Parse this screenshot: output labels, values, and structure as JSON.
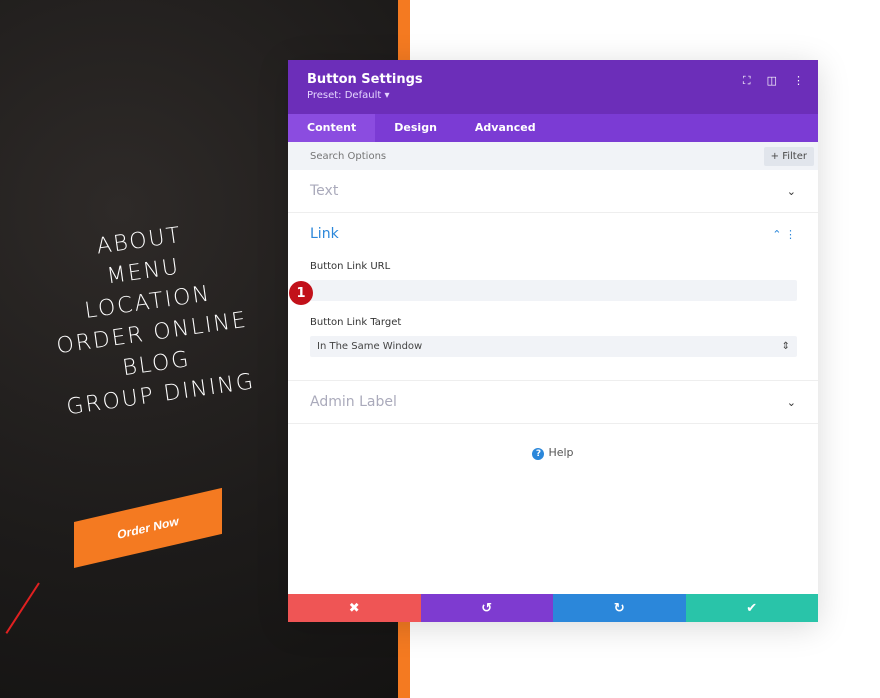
{
  "page": {
    "menu": [
      "ABOUT",
      "MENU",
      "LOCATION",
      "ORDER ONLINE",
      "BLOG",
      "GROUP DINING"
    ],
    "order_button": "Order Now",
    "step_badge": "1"
  },
  "modal": {
    "title": "Button Settings",
    "preset": "Preset: Default ▾",
    "tabs": [
      "Content",
      "Design",
      "Advanced"
    ],
    "search_placeholder": "Search Options",
    "filter": "+ Filter",
    "sections": {
      "text": "Text",
      "link": "Link",
      "admin": "Admin Label"
    },
    "link_url_label": "Button Link URL",
    "link_url_value": "",
    "link_target_label": "Button Link Target",
    "link_target_value": "In The Same Window",
    "help": "Help",
    "footer_icons": [
      "close-icon",
      "undo-icon",
      "redo-icon",
      "check-icon"
    ]
  },
  "colors": {
    "header": "#6c2eb9",
    "tabs": "#7b3bd4",
    "accent_orange": "#f47a21",
    "cancel": "#ef5555",
    "undo": "#7e3bd0",
    "redo": "#2b87da",
    "save": "#29c4a9"
  }
}
